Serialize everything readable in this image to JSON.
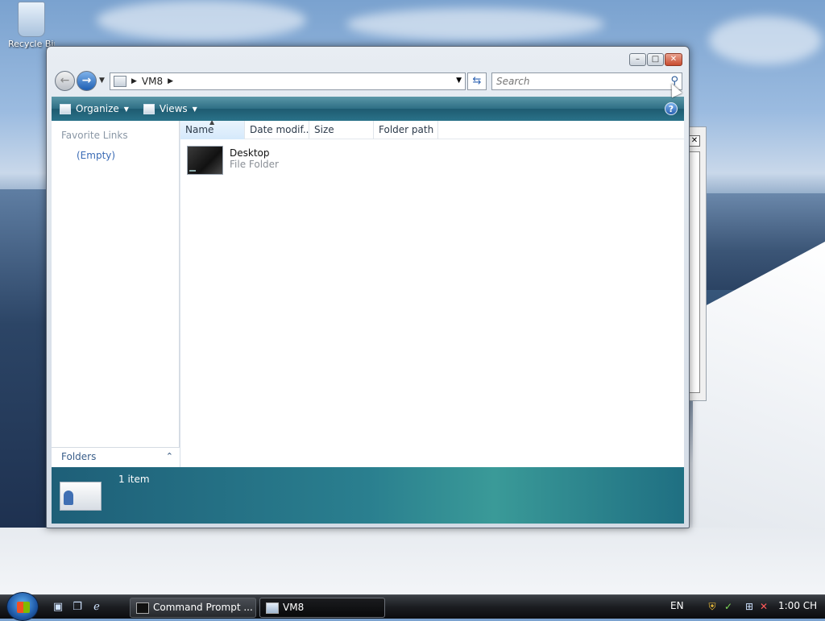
{
  "desktop": {
    "recycle_bin_label": "Recycle Bin"
  },
  "window": {
    "title_buttons": {
      "minimize": "–",
      "maximize": "□",
      "close": "✕"
    },
    "address": {
      "crumbs": [
        "VM8"
      ]
    },
    "search": {
      "placeholder": "Search"
    },
    "toolbar": {
      "organize": "Organize",
      "views": "Views",
      "help": "?"
    },
    "favorite_links": {
      "title": "Favorite Links",
      "empty": "(Empty)"
    },
    "folders_label": "Folders",
    "columns": [
      "Name",
      "Date modif...",
      "Size",
      "Folder path"
    ],
    "items": [
      {
        "name": "Desktop",
        "type": "File Folder"
      }
    ],
    "details": {
      "count": "1 item"
    }
  },
  "taskbar": {
    "tasks": [
      {
        "label": "Command Prompt ...",
        "active": false
      },
      {
        "label": "VM8",
        "active": true
      }
    ],
    "language": "EN",
    "clock": "1:00 CH"
  }
}
